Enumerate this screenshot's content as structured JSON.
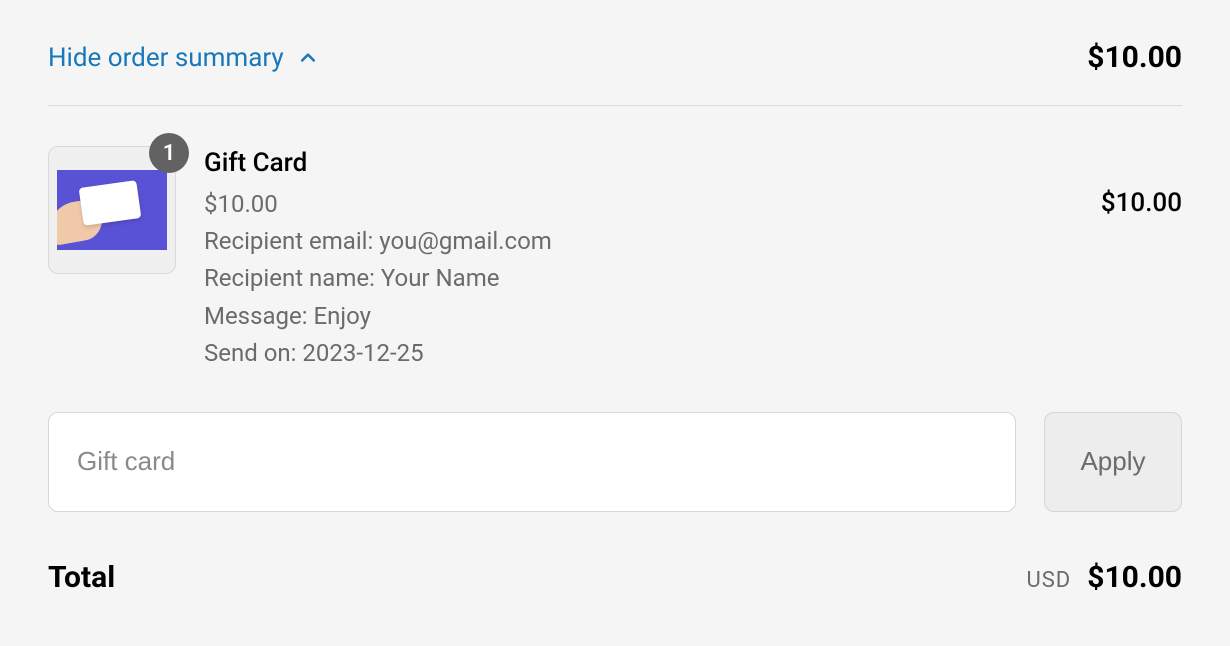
{
  "summary": {
    "toggle_label": "Hide order summary",
    "total_preview": "$10.00"
  },
  "line_item": {
    "quantity": "1",
    "name": "Gift Card",
    "variant_price": "$10.00",
    "recipient_email": "Recipient email: you@gmail.com",
    "recipient_name": "Recipient name: Your Name",
    "message": "Message: Enjoy",
    "send_on": "Send on: 2023-12-25",
    "price": "$10.00"
  },
  "gift_card": {
    "placeholder": "Gift card",
    "apply_label": "Apply"
  },
  "total": {
    "label": "Total",
    "currency": "USD",
    "amount": "$10.00"
  }
}
